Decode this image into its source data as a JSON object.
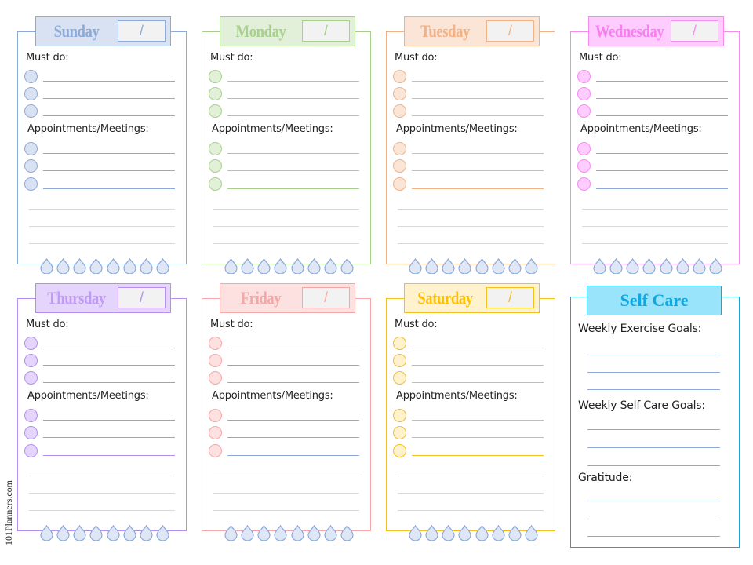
{
  "labels": {
    "must_do": "Must do:",
    "appointments": "Appointments/Meetings:",
    "date_separator": "/"
  },
  "days": [
    {
      "name": "Sunday",
      "colors": {
        "border": "#8eaad8",
        "fill": "#d9e2f3",
        "text": "#8eaad8",
        "line": "#8eaad8"
      }
    },
    {
      "name": "Monday",
      "colors": {
        "border": "#a8d08d",
        "fill": "#e2efd9",
        "text": "#a8d08d",
        "line": "#a8d08d"
      }
    },
    {
      "name": "Tuesday",
      "colors": {
        "border": "#f4b183",
        "fill": "#fbe5d6",
        "text": "#f4b183",
        "line": "#f4b183"
      }
    },
    {
      "name": "Wednesday",
      "colors": {
        "border": "#f58cf0",
        "fill": "#ffccff",
        "text": "#f77ff2",
        "line": "#8eaad8"
      }
    },
    {
      "name": "Thursday",
      "colors": {
        "border": "#b48ef0",
        "fill": "#e5d5fc",
        "text": "#c09af5",
        "line": "#b48ef0"
      }
    },
    {
      "name": "Friday",
      "colors": {
        "border": "#f4a7a7",
        "fill": "#fde0e0",
        "text": "#f4a7a7",
        "line": "#8eaad8"
      }
    },
    {
      "name": "Saturday",
      "colors": {
        "border": "#f4c020",
        "fill": "#fff2cc",
        "text": "#ffc000",
        "line": "#f4c020"
      }
    }
  ],
  "water_drops_per_day": 8,
  "self_care": {
    "title": "Self Care",
    "sections": [
      {
        "label": "Weekly Exercise Goals:"
      },
      {
        "label": "Weekly Self Care Goals:"
      },
      {
        "label": "Gratitude:"
      }
    ]
  },
  "watermark": "101Planners.com"
}
